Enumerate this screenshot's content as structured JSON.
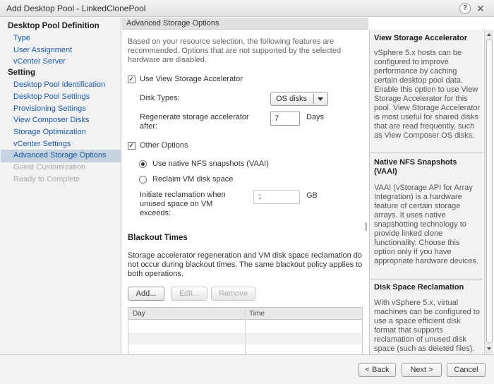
{
  "window": {
    "title": "Add Desktop Pool - LinkedClonePool",
    "help_glyph": "?",
    "close_glyph": "✕"
  },
  "nav": {
    "section1": "Desktop Pool Definition",
    "section1_items": [
      "Type",
      "User Assignment",
      "vCenter Server"
    ],
    "section2": "Setting",
    "section2_items": [
      "Desktop Pool Identification",
      "Desktop Pool Settings",
      "Provisioning Settings",
      "View Composer Disks",
      "Storage Optimization",
      "vCenter Settings",
      "Advanced Storage Options"
    ],
    "disabled_items": [
      "Guest Customization",
      "Ready to Complete"
    ],
    "selected": "Advanced Storage Options"
  },
  "main": {
    "header": "Advanced Storage Options",
    "intro": "Based on your resource selection, the following features are recommended. Options that are not supported by the selected hardware are disabled.",
    "accelerator": {
      "checkbox_label": "Use View Storage Accelerator",
      "checked": true,
      "disk_types_label": "Disk Types:",
      "disk_types_value": "OS disks",
      "regen_label": "Regenerate storage accelerator after:",
      "regen_value": "7",
      "regen_unit": "Days"
    },
    "other": {
      "checkbox_label": "Other Options",
      "checked": true,
      "radio1": "Use native NFS snapshots (VAAI)",
      "radio2": "Reclaim VM disk space",
      "reclaim_label": "Initiate reclamation when unused space on VM exceeds:",
      "reclaim_value": "1",
      "reclaim_unit": "GB"
    },
    "blackout": {
      "title": "Blackout Times",
      "desc": "Storage accelerator regeneration and VM disk space reclamation do not occur during blackout times. The same blackout policy applies to both operations.",
      "add": "Add...",
      "edit": "Edit...",
      "remove": "Remove",
      "col_day": "Day",
      "col_time": "Time"
    }
  },
  "help": {
    "t1": "View Storage Accelerator",
    "b1": "vSphere 5.x hosts can be configured to improve performance by caching certain desktop pool data. Enable this option to use View Storage Accelerator for this pool. View Storage Accelerator is most useful for shared disks that are read frequently, such as View Composer OS disks.",
    "t2": "Native NFS Snapshots (VAAI)",
    "b2": "VAAI (vStorage API for Array Integration) is a hardware feature of certain storage arrays. It uses native snapshotting technology to provide linked clone functionality. Choose this option only if you have appropriate hardware devices.",
    "t3": "Disk Space Reclamation",
    "b3": "With vSphere 5.x, virtual machines can be configured to use a space efficient disk format that supports reclamation of unused disk space (such as deleted files)."
  },
  "footer": {
    "back": "< Back",
    "next": "Next >",
    "cancel": "Cancel"
  }
}
